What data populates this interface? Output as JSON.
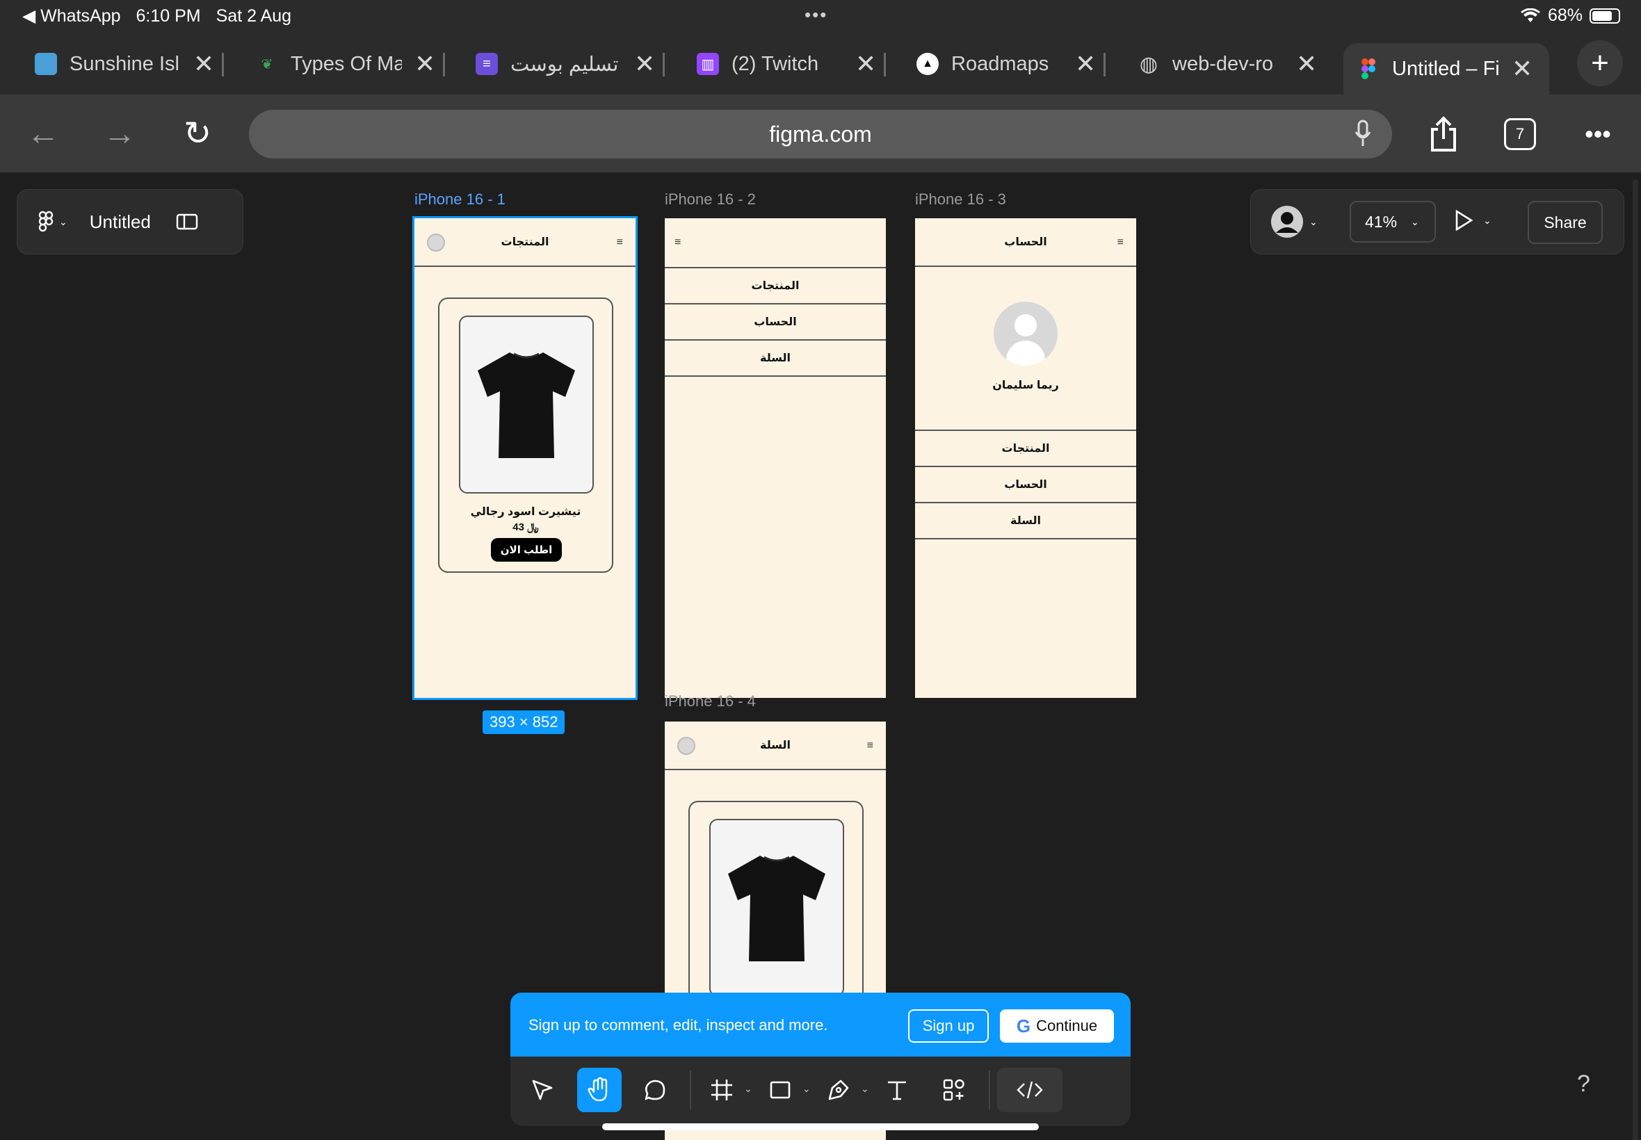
{
  "status_bar": {
    "back_app": "WhatsApp",
    "time": "6:10 PM",
    "date": "Sat 2 Aug",
    "battery": "68%",
    "battery_level": 0.68
  },
  "tabs": [
    {
      "label": "Sunshine Isl",
      "icon": "image-favicon",
      "color": "#4a9fd8"
    },
    {
      "label": "Types Of Ma",
      "icon": "leaf-favicon",
      "color": "#3aa655"
    },
    {
      "label": "تسليم بوست",
      "icon": "list-favicon",
      "color": "#6b4fd8"
    },
    {
      "label": "(2) Twitch",
      "icon": "twitch-favicon",
      "color": "#9146ff"
    },
    {
      "label": "Roadmaps",
      "icon": "roadmap-favicon",
      "color": "#ffffff"
    },
    {
      "label": "web-dev-ro",
      "icon": "globe-favicon",
      "color": "#cfcfcf"
    },
    {
      "label": "Untitled – Fi",
      "icon": "figma-favicon",
      "color": "#f24e1e",
      "active": true
    }
  ],
  "address_bar": {
    "url": "figma.com",
    "tab_count": "7"
  },
  "figma": {
    "file_name": "Untitled",
    "zoom": "41%",
    "share_label": "Share",
    "frames": {
      "f1": {
        "label": "iPhone 16 - 1",
        "size": "393 × 852",
        "header_title": "المنتجات",
        "product_name": "تيشيرت اسود رجالي",
        "product_price": "43 ﷼",
        "order_button": "اطلب الان"
      },
      "f2": {
        "label": "iPhone 16 - 2",
        "menu": [
          "المنتجات",
          "الحساب",
          "السلة"
        ]
      },
      "f3": {
        "label": "iPhone 16 - 3",
        "header_title": "الحساب",
        "user_name": "ريما سليمان",
        "menu": [
          "المنتجات",
          "الحساب",
          "السلة"
        ]
      },
      "f4": {
        "label": "iPhone 16 - 4",
        "header_title": "السلة"
      }
    },
    "banner": {
      "message": "Sign up to comment, edit, inspect and more.",
      "signup_label": "Sign up",
      "continue_label": "Continue",
      "google_glyph": "G"
    },
    "help": "?"
  },
  "colors": {
    "accent": "#0d99ff",
    "frame_bg": "#fdf3e2",
    "canvas_bg": "#1e1e1e"
  }
}
